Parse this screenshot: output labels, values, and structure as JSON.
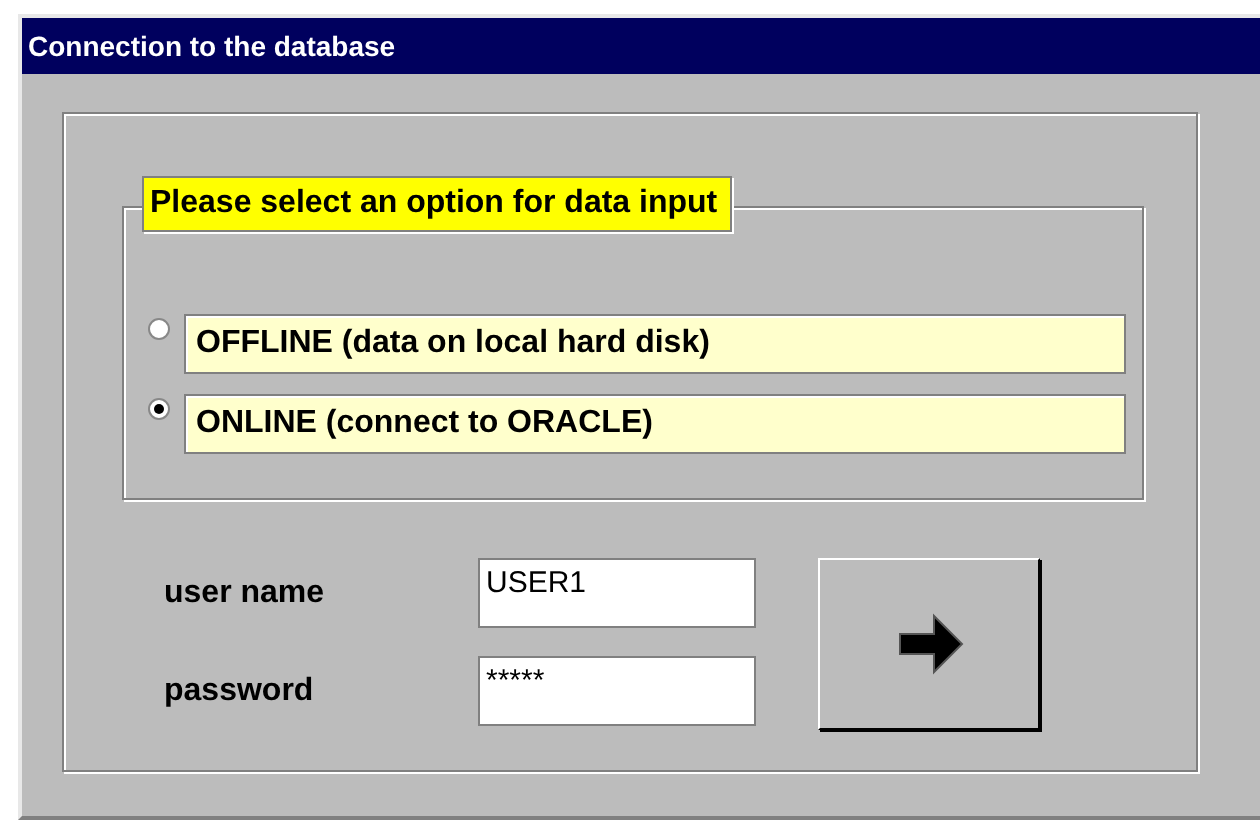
{
  "window": {
    "title": "Connection to the database"
  },
  "option_group": {
    "legend": "Please select an option for data input",
    "options": [
      {
        "label": "OFFLINE (data on local hard disk)",
        "selected": false
      },
      {
        "label": "ONLINE (connect to ORACLE)",
        "selected": true
      }
    ]
  },
  "fields": [
    {
      "label": "user name",
      "value": "USER1"
    },
    {
      "label": "password",
      "value": "*****"
    }
  ]
}
